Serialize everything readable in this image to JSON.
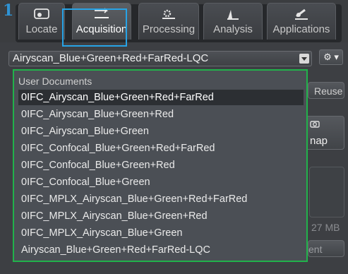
{
  "step_marker": "1",
  "tabs": [
    {
      "label": "Locate",
      "icon": "locate-icon"
    },
    {
      "label": "Acquisition",
      "icon": "acquisition-icon",
      "active": true
    },
    {
      "label": "Processing",
      "icon": "processing-icon"
    },
    {
      "label": "Analysis",
      "icon": "analysis-icon"
    },
    {
      "label": "Applications",
      "icon": "applications-icon"
    }
  ],
  "experiment": {
    "selected_value": "Airyscan_Blue+Green+Red+FarRed-LQC",
    "gear_label": "⚙ ▾"
  },
  "background": {
    "reuse_label": "Reuse",
    "snap_label": "nap",
    "size_text": "27 MB",
    "ent_label": "ent"
  },
  "dropdown": {
    "group_header": "User Documents",
    "items": [
      "0IFC_Airyscan_Blue+Green+Red+FarRed",
      "0IFC_Airyscan_Blue+Green+Red",
      "0IFC_Airyscan_Blue+Green",
      "0IFC_Confocal_Blue+Green+Red+FarRed",
      "0IFC_Confocal_Blue+Green+Red",
      "0IFC_Confocal_Blue+Green",
      "0IFC_MPLX_Airyscan_Blue+Green+Red+FarRed",
      "0IFC_MPLX_Airyscan_Blue+Green+Red",
      "0IFC_MPLX_Airyscan_Blue+Green",
      "Airyscan_Blue+Green+Red+FarRed-LQC"
    ],
    "selected_index": 0
  },
  "colors": {
    "highlight_blue": "#27a3e6",
    "highlight_green": "#21b24b",
    "marker_blue": "#2f93d4"
  }
}
